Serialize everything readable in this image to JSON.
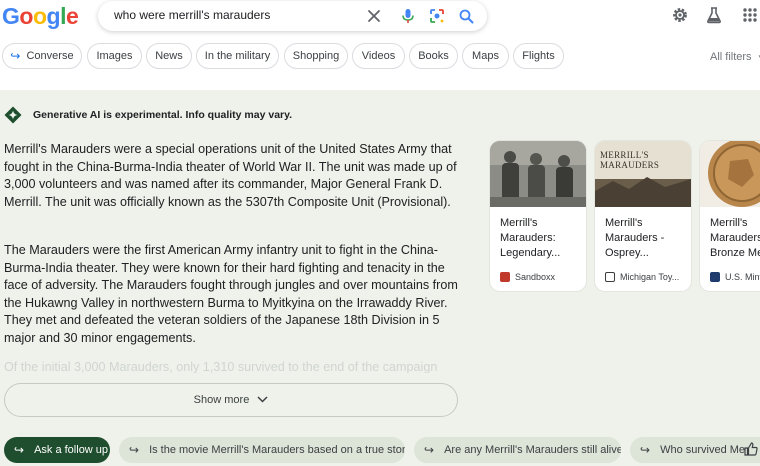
{
  "header": {
    "logo": [
      "G",
      "o",
      "o",
      "g",
      "l",
      "e"
    ],
    "search_query": "who were merrill's marauders",
    "icons": [
      "clear-icon",
      "mic-icon",
      "lens-icon",
      "search-icon",
      "gear-icon",
      "labs-icon",
      "apps-icon"
    ]
  },
  "chips": [
    {
      "label": "Converse"
    },
    {
      "label": "Images"
    },
    {
      "label": "News"
    },
    {
      "label": "In the military"
    },
    {
      "label": "Shopping"
    },
    {
      "label": "Videos"
    },
    {
      "label": "Books"
    },
    {
      "label": "Maps"
    },
    {
      "label": "Flights"
    }
  ],
  "all_filters": "All filters",
  "overview": {
    "label": "Generative AI is experimental. Info quality may vary.",
    "paragraphs": [
      "Merrill's Marauders were a special operations unit of the United States Army that fought in the China-Burma-India theater of World War II. The unit was made up of 3,000 volunteers and was named after its commander, Major General Frank D. Merrill. The unit was officially known as the 5307th Composite Unit (Provisional).",
      "The Marauders were the first American Army infantry unit to fight in the China-Burma-India theater. They were known for their hard fighting and tenacity in the face of adversity. The Marauders fought through jungles and over mountains from the Hukawng Valley in northwestern Burma to Myitkyina on the Irrawaddy River. They met and defeated the veteran soldiers of the Japanese 18th Division in 5 major and 30 minor engagements.",
      "Of the initial 3,000 Marauders, only 1,310 survived to the end of the campaign"
    ],
    "show_more": "Show more"
  },
  "cards": [
    {
      "title": "Merrill's Marauders: Legendary...",
      "source": "Sandboxx",
      "fav_color": "#c0392b"
    },
    {
      "title": "Merrill's Marauders - Osprey...",
      "source": "Michigan Toy...",
      "fav_color": "#3c3c3c",
      "thumb_text": [
        "MERRILL'S",
        "MARAUDERS"
      ]
    },
    {
      "title": "Merrill's Marauders Bronze Me...",
      "source": "U.S. Mint",
      "fav_color": "#1f3b6e"
    }
  ],
  "followups": {
    "primary": "Ask a follow up",
    "items": [
      "Is the movie Merrill's Marauders based on a true story?",
      "Are any Merrill's Marauders still alive?",
      "Who survived Me"
    ]
  }
}
